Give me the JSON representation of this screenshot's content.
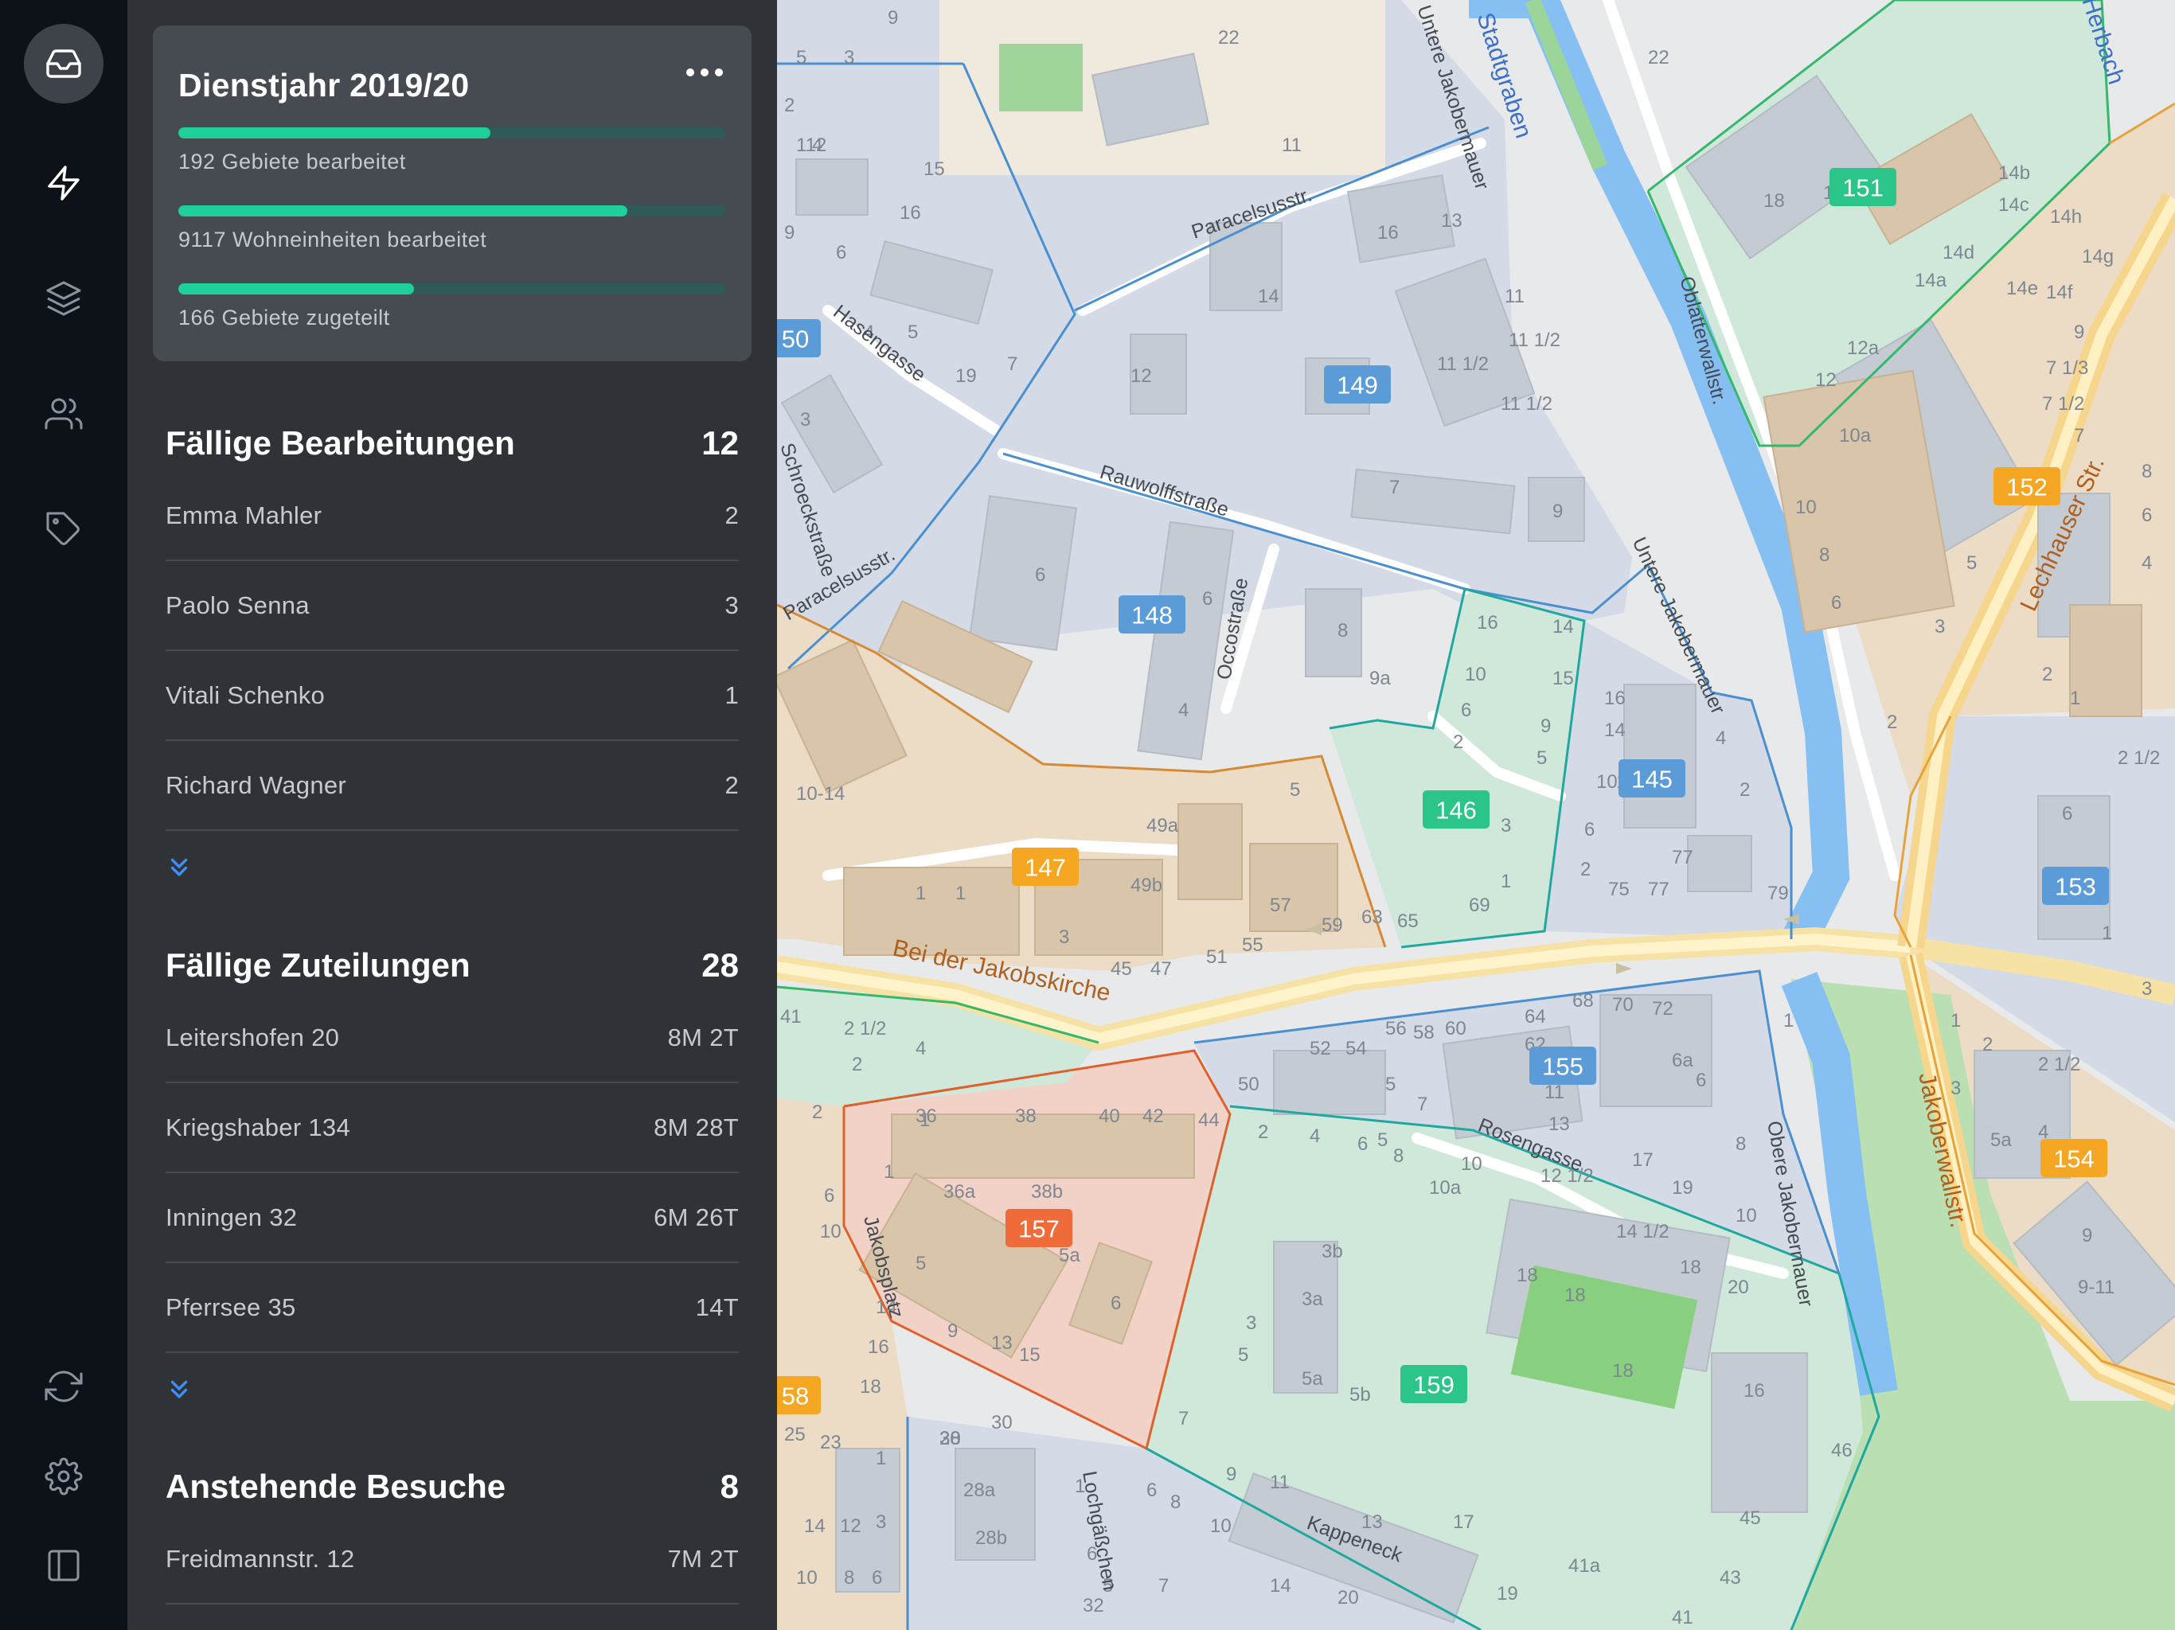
{
  "colors": {
    "rail_bg": "#0c1218",
    "panel_bg": "#2f3337",
    "card_bg": "#464b51",
    "progress_fill": "#20d09a",
    "expand_icon": "#3d8ff0",
    "badge_blue": "#5b9bd8",
    "badge_green": "#2bc58a",
    "badge_orange": "#f5a623",
    "badge_red": "#ef6b3a"
  },
  "rail": {
    "items": [
      {
        "icon": "inbox-icon",
        "active": true
      },
      {
        "icon": "lightning-icon"
      },
      {
        "icon": "layers-icon"
      },
      {
        "icon": "users-icon"
      },
      {
        "icon": "tag-icon"
      }
    ],
    "bottom_items": [
      {
        "icon": "sync-icon"
      },
      {
        "icon": "settings-gear-icon"
      },
      {
        "icon": "sidebar-toggle-icon"
      }
    ]
  },
  "year_card": {
    "title": "Dienstjahr 2019/20",
    "menu_icon": "more-horizontal-icon",
    "stats": [
      {
        "label": "192 Gebiete bearbeitet",
        "progress": 0.57
      },
      {
        "label": "9117 Wohneinheiten bearbeitet",
        "progress": 0.82
      },
      {
        "label": "166 Gebiete zugeteilt",
        "progress": 0.43
      }
    ]
  },
  "sections": {
    "due_edits": {
      "title": "Fällige Bearbeitungen",
      "count": "12",
      "rows": [
        {
          "name": "Emma Mahler",
          "value": "2"
        },
        {
          "name": "Paolo Senna",
          "value": "3"
        },
        {
          "name": "Vitali Schenko",
          "value": "1"
        },
        {
          "name": "Richard Wagner",
          "value": "2"
        }
      ],
      "expand_icon": "chevrons-down-icon"
    },
    "due_assignments": {
      "title": "Fällige Zuteilungen",
      "count": "28",
      "rows": [
        {
          "name": "Leitershofen 20",
          "value": "8M 2T"
        },
        {
          "name": "Kriegshaber 134",
          "value": "8M 28T"
        },
        {
          "name": "Inningen 32",
          "value": "6M 26T"
        },
        {
          "name": "Pferrsee 35",
          "value": "14T"
        }
      ],
      "expand_icon": "chevrons-down-icon"
    },
    "upcoming_visits": {
      "title": "Anstehende Besuche",
      "count": "8",
      "rows": [
        {
          "name": "Freidmannstr. 12",
          "value": "7M 2T"
        }
      ]
    }
  },
  "map": {
    "territories": [
      {
        "label": "149",
        "color": "blue"
      },
      {
        "label": "148",
        "color": "blue"
      },
      {
        "label": "145",
        "color": "blue"
      },
      {
        "label": "146",
        "color": "green"
      },
      {
        "label": "147",
        "color": "orange"
      },
      {
        "label": "151",
        "color": "green"
      },
      {
        "label": "152",
        "color": "orange"
      },
      {
        "label": "153",
        "color": "blue"
      },
      {
        "label": "154",
        "color": "orange"
      },
      {
        "label": "155",
        "color": "blue"
      },
      {
        "label": "157",
        "color": "red"
      },
      {
        "label": "159",
        "color": "green"
      },
      {
        "label": "50",
        "color": "blue"
      },
      {
        "label": "58",
        "color": "orange"
      }
    ],
    "streets": [
      "Paracelsusstr.",
      "Hasengasse",
      "Schroeckstraße",
      "Rauwolffstraße",
      "Occostraße",
      "Untere Jakobermauer",
      "Stadtgraben",
      "Oblatterwallstr.",
      "Lechhauser Str.",
      "Bei der Jakobskirche",
      "Rosengasse",
      "Obere Jakobermauer",
      "Jakoberwallstr.",
      "Jakobsplatz",
      "Lochgäßchen",
      "Kappeneck",
      "Herbach"
    ]
  }
}
